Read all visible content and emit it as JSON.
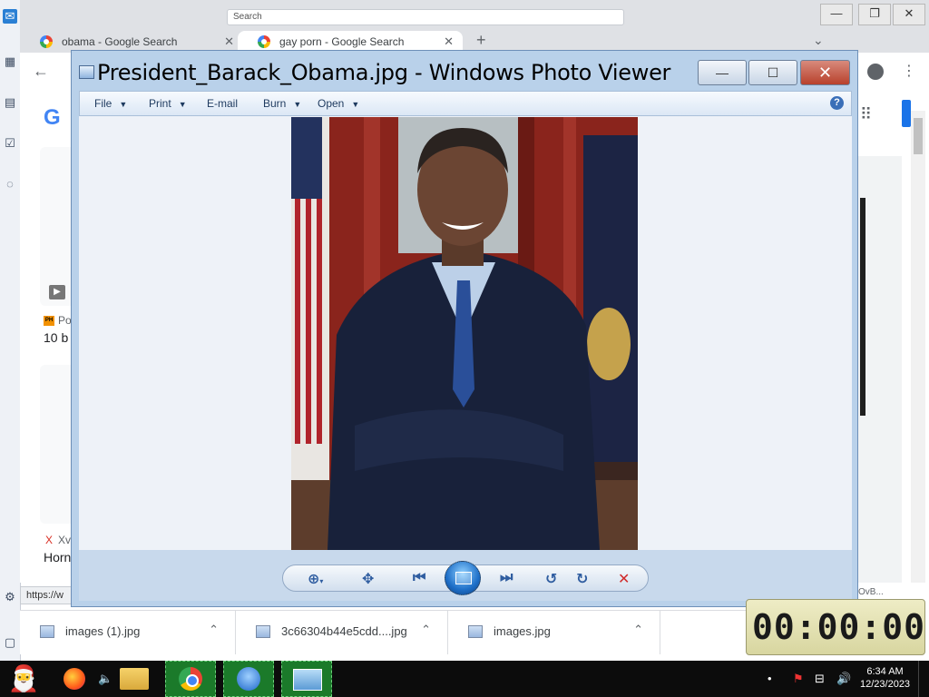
{
  "browser": {
    "top_search_placeholder": "Search",
    "tabs": [
      {
        "title": "obama - Google Search"
      },
      {
        "title": "gay porn - Google Search"
      }
    ],
    "new_tab": "+",
    "menu_chevron": "⌄",
    "window_buttons": [
      "—",
      "❐",
      "✕"
    ],
    "status_url": "https://w",
    "partial_left": {
      "source_label": "Po",
      "text1": "10 b",
      "source2": "Xv",
      "text2": "Horn"
    },
    "partial_right": "OvB..."
  },
  "photo_viewer": {
    "title": "President_Barack_Obama.jpg - Windows Photo Viewer",
    "menu": [
      {
        "label": "File",
        "has_dropdown": true
      },
      {
        "label": "Print",
        "has_dropdown": true
      },
      {
        "label": "E-mail",
        "has_dropdown": false
      },
      {
        "label": "Burn",
        "has_dropdown": true
      },
      {
        "label": "Open",
        "has_dropdown": true
      }
    ],
    "help": "?",
    "controls": [
      "zoom-icon",
      "actual-size-icon",
      "previous-icon",
      "slideshow-icon",
      "next-icon",
      "rotate-left-icon",
      "rotate-right-icon",
      "delete-icon"
    ]
  },
  "downloads": [
    {
      "name": "images (1).jpg"
    },
    {
      "name": "3c66304b44e5cdd....jpg"
    },
    {
      "name": "images.jpg"
    }
  ],
  "timer": {
    "display": "00:00:00"
  },
  "taskbar": {
    "time": "6:34 AM",
    "date": "12/23/2023"
  }
}
